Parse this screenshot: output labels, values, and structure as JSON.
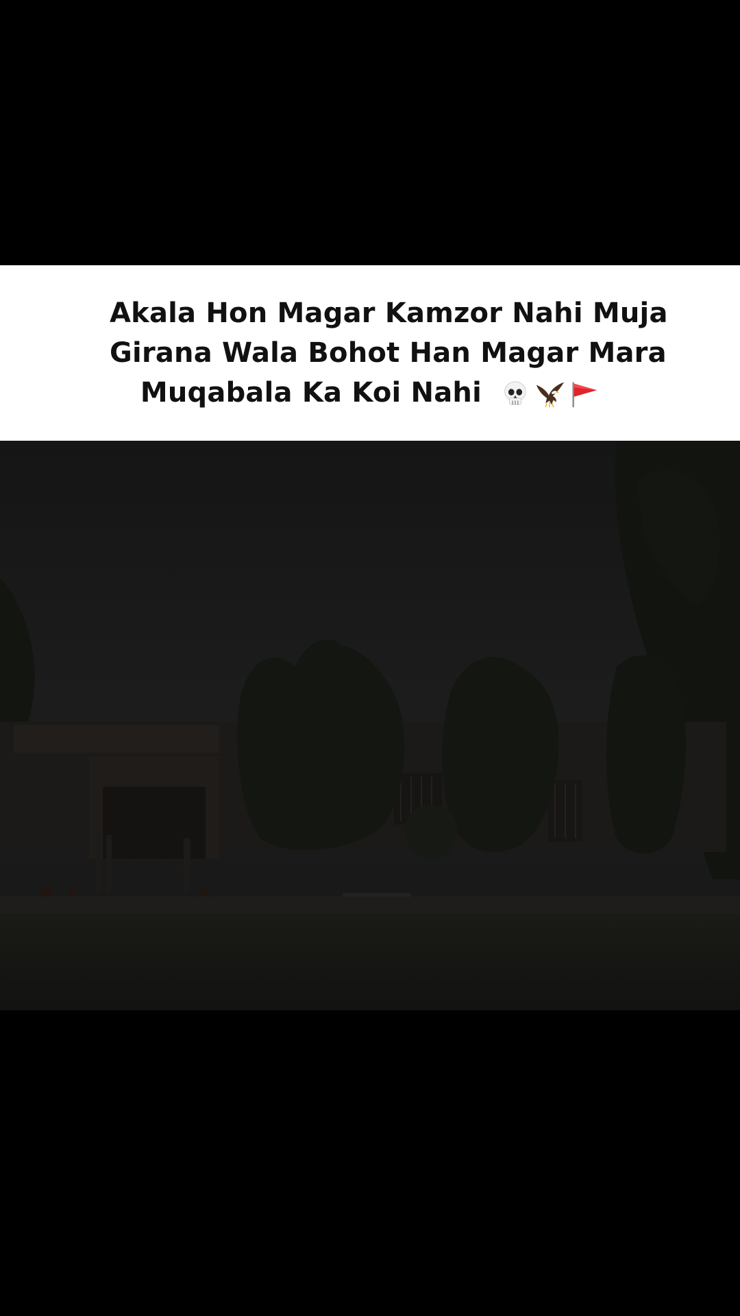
{
  "caption": {
    "line1": "Akala Hon Magar Kamzor Nahi Muja",
    "line2": "Girana Wala Bohot Han Magar Mara",
    "line3": "Muqabala Ka Koi Nahi",
    "emojis": [
      "skull-icon",
      "eagle-icon",
      "triangular-flag-icon"
    ]
  },
  "photo": {
    "description_icon": "campus-building-with-trees-icon",
    "tone": "#141414"
  }
}
